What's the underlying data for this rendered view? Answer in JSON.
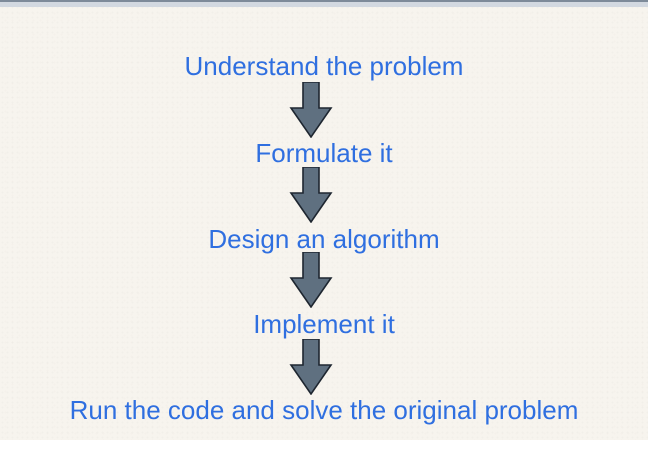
{
  "diagram": {
    "steps": [
      "Understand the problem",
      "Formulate it",
      "Design an algorithm",
      "Implement it",
      "Run the code and solve the original problem"
    ],
    "colors": {
      "text": "#2f6fe0",
      "arrow_fill": "#5f7080",
      "arrow_stroke": "#1e2630",
      "background": "#f7f4ee"
    },
    "icons": [
      "down-arrow-icon"
    ]
  }
}
